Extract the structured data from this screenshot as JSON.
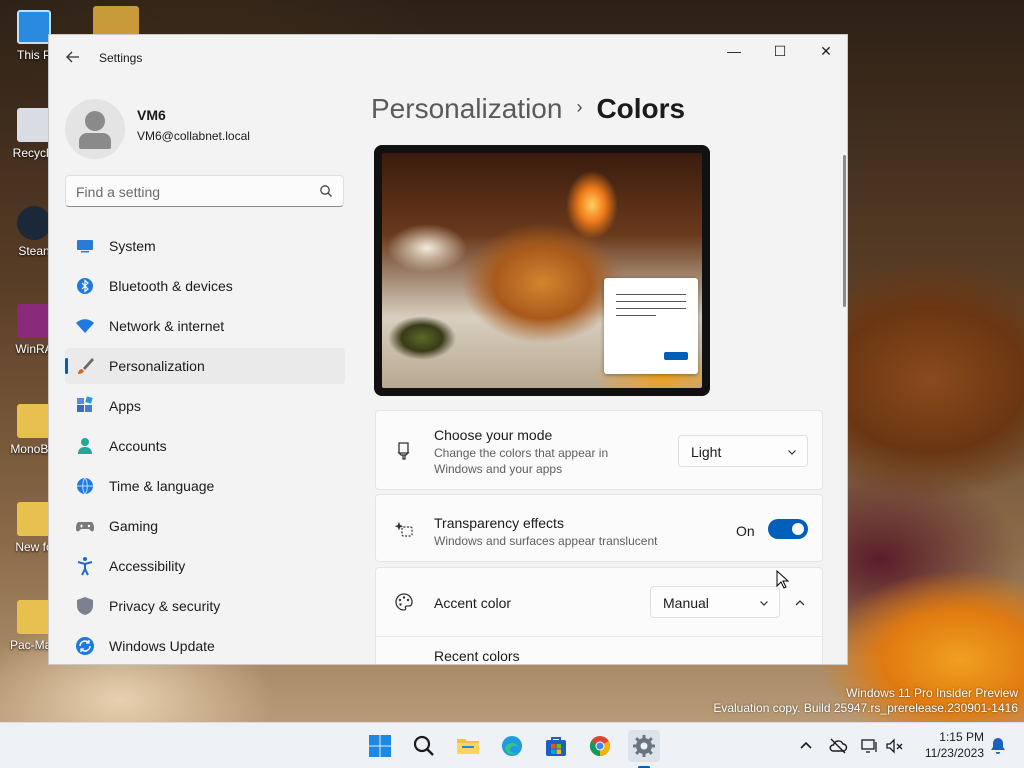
{
  "desktop": {
    "icons": [
      {
        "label": "This P",
        "color": "#2a8adf"
      },
      {
        "label": "Recycle",
        "color": "#d8dde3"
      },
      {
        "label": "Stean",
        "color": "#1b2838"
      },
      {
        "label": "WinRA",
        "color": "#8a2a7a"
      },
      {
        "label": "MonoBle",
        "color": "#e8c050"
      },
      {
        "label": "New fo",
        "color": "#e8c050"
      },
      {
        "label": "Pac-Man",
        "color": "#e8c050"
      }
    ],
    "watermark": {
      "line1": "Windows 11 Pro Insider Preview",
      "line2": "Evaluation copy. Build 25947.rs_prerelease.230901-1416"
    }
  },
  "window": {
    "title": "Settings",
    "back_icon": "arrow-left-icon",
    "minimize_glyph": "—",
    "maximize_glyph": "☐",
    "close_glyph": "✕"
  },
  "profile": {
    "name": "VM6",
    "email": "VM6@collabnet.local"
  },
  "search": {
    "placeholder": "Find a setting"
  },
  "nav": {
    "items": [
      {
        "label": "System",
        "icon": "display-icon",
        "color": "#2a7ad8"
      },
      {
        "label": "Bluetooth & devices",
        "icon": "bluetooth-icon",
        "color": "#1f7ae0"
      },
      {
        "label": "Network & internet",
        "icon": "wifi-icon",
        "color": "#1f7ae0"
      },
      {
        "label": "Personalization",
        "icon": "brush-icon",
        "color": "#d06a2a",
        "active": true
      },
      {
        "label": "Apps",
        "icon": "apps-icon",
        "color": "#3a6ac8"
      },
      {
        "label": "Accounts",
        "icon": "person-icon",
        "color": "#20a89a"
      },
      {
        "label": "Time & language",
        "icon": "globe-icon",
        "color": "#1f7ae0"
      },
      {
        "label": "Gaming",
        "icon": "gamepad-icon",
        "color": "#7a7a7a"
      },
      {
        "label": "Accessibility",
        "icon": "accessibility-icon",
        "color": "#1f6ad0"
      },
      {
        "label": "Privacy & security",
        "icon": "shield-icon",
        "color": "#7a8290"
      },
      {
        "label": "Windows Update",
        "icon": "update-icon",
        "color": "#1f7ae0"
      }
    ]
  },
  "main": {
    "breadcrumb_parent": "Personalization",
    "breadcrumb_separator": "›",
    "breadcrumb_current": "Colors",
    "mode": {
      "title": "Choose your mode",
      "description": "Change the colors that appear in Windows and your apps",
      "value": "Light"
    },
    "transparency": {
      "title": "Transparency effects",
      "description": "Windows and surfaces appear translucent",
      "state_label": "On",
      "enabled": true
    },
    "accent": {
      "title": "Accent color",
      "value": "Manual",
      "recent_colors_label": "Recent colors"
    }
  },
  "taskbar": {
    "apps": [
      {
        "name": "start-button",
        "icon": "windows-logo-icon"
      },
      {
        "name": "search-button",
        "icon": "search-icon"
      },
      {
        "name": "file-explorer-button",
        "icon": "folder-icon"
      },
      {
        "name": "edge-button",
        "icon": "edge-icon"
      },
      {
        "name": "store-button",
        "icon": "store-icon"
      },
      {
        "name": "chrome-button",
        "icon": "chrome-icon"
      },
      {
        "name": "settings-button",
        "icon": "gear-icon",
        "active": true
      }
    ],
    "clock": {
      "time": "1:15 PM",
      "date": "11/23/2023"
    }
  },
  "colors": {
    "accent": "#005fb8",
    "window_bg": "#f3f3f3",
    "card_bg": "#fbfbfb"
  }
}
